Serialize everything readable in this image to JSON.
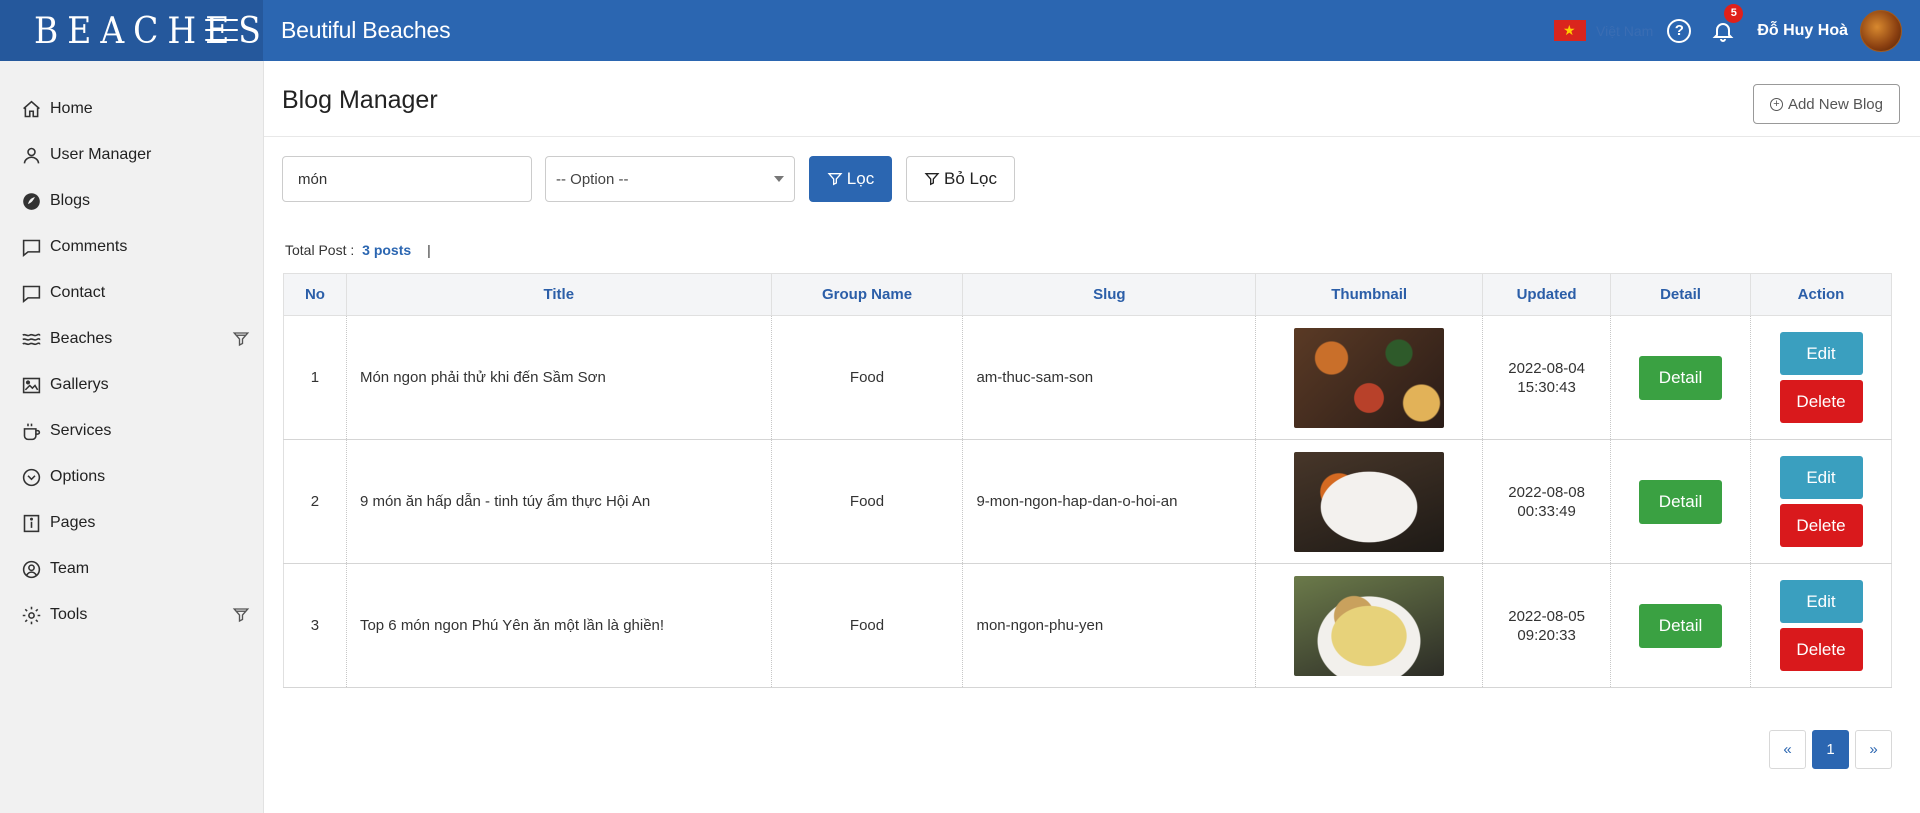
{
  "header": {
    "brand": "BEACHES",
    "title": "Beutiful Beaches",
    "language": "Việt Nam",
    "notification_count": "5",
    "username": "Đỗ Huy Hoà"
  },
  "sidebar": {
    "items": [
      {
        "label": "Home",
        "icon": "home-icon"
      },
      {
        "label": "User Manager",
        "icon": "user-icon"
      },
      {
        "label": "Blogs",
        "icon": "blog-icon"
      },
      {
        "label": "Comments",
        "icon": "comment-icon"
      },
      {
        "label": "Contact",
        "icon": "contact-icon"
      },
      {
        "label": "Beaches",
        "icon": "waves-icon"
      },
      {
        "label": "Gallerys",
        "icon": "image-icon"
      },
      {
        "label": "Services",
        "icon": "cup-icon"
      },
      {
        "label": "Options",
        "icon": "chevron-circle-icon"
      },
      {
        "label": "Pages",
        "icon": "info-icon"
      },
      {
        "label": "Team",
        "icon": "user-circle-icon"
      },
      {
        "label": "Tools",
        "icon": "gear-icon"
      }
    ]
  },
  "page": {
    "title": "Blog Manager",
    "add_button": "Add New Blog"
  },
  "filters": {
    "search_value": "món",
    "select_value": "-- Option --",
    "filter_button": "Lọc",
    "clear_button": "Bỏ Lọc"
  },
  "summary": {
    "label": "Total Post :",
    "count": "3 posts",
    "separator": "|"
  },
  "table": {
    "columns": [
      "No",
      "Title",
      "Group Name",
      "Slug",
      "Thumbnail",
      "Updated",
      "Detail",
      "Action"
    ],
    "rows": [
      {
        "no": "1",
        "title": "Món ngon phải thử khi đến Sầm Sơn",
        "group": "Food",
        "slug": "am-thuc-sam-son",
        "date": "2022-08-04",
        "time": "15:30:43",
        "detail": "Detail",
        "edit": "Edit",
        "delete": "Delete"
      },
      {
        "no": "2",
        "title": "9 món ăn hấp dẫn - tinh túy ẩm thực Hội An",
        "group": "Food",
        "slug": "9-mon-ngon-hap-dan-o-hoi-an",
        "date": "2022-08-08",
        "time": "00:33:49",
        "detail": "Detail",
        "edit": "Edit",
        "delete": "Delete"
      },
      {
        "no": "3",
        "title": "Top 6 món ngon Phú Yên ăn một lần là ghiền!",
        "group": "Food",
        "slug": "mon-ngon-phu-yen",
        "date": "2022-08-05",
        "time": "09:20:33",
        "detail": "Detail",
        "edit": "Edit",
        "delete": "Delete"
      }
    ]
  },
  "pagination": {
    "prev": "«",
    "current": "1",
    "next": "»"
  },
  "colors": {
    "primary": "#2b66b1",
    "success": "#3aa142",
    "info": "#3a9fbf",
    "danger": "#d9191c"
  }
}
